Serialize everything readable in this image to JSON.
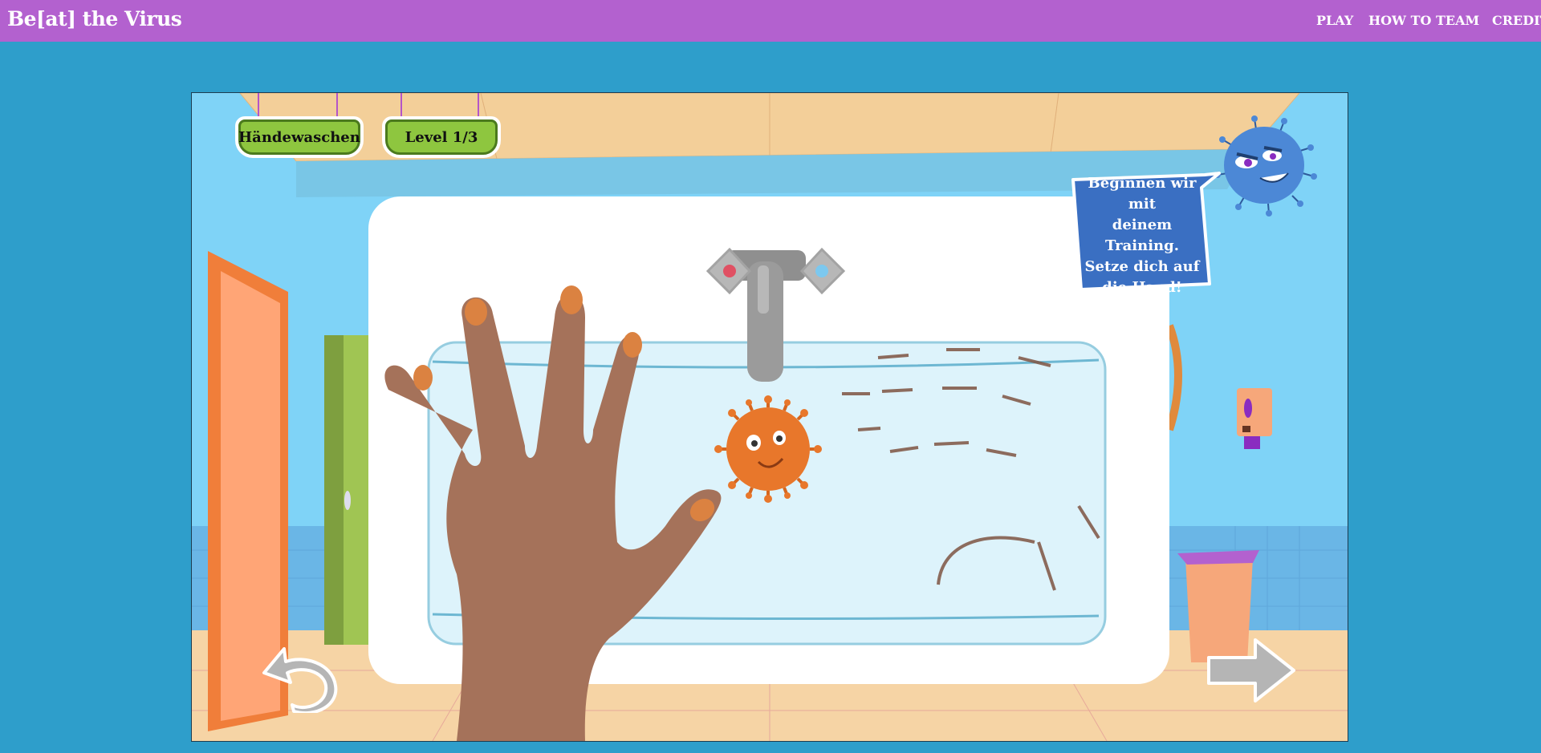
{
  "header": {
    "brand": "Be[at] the Virus",
    "nav": [
      "PLAY",
      "HOW TO",
      "TEAM",
      "CREDITS"
    ]
  },
  "game": {
    "topic_sign": "Händewaschen",
    "level_sign": "Level 1/3",
    "speech": "Beginnen wir mit\ndeinem Training.\nSetze dich auf\ndie Hand!",
    "icons": [
      "undo-arrow-icon",
      "next-arrow-icon"
    ]
  },
  "colors": {
    "header": "#b361cf",
    "background": "#2e9ecb",
    "sign_green": "#8ec63f",
    "bubble_blue": "#3a6fc2",
    "skin": "#a5725a",
    "virus_orange": "#e8772b",
    "villain_blue": "#4c88d6"
  }
}
